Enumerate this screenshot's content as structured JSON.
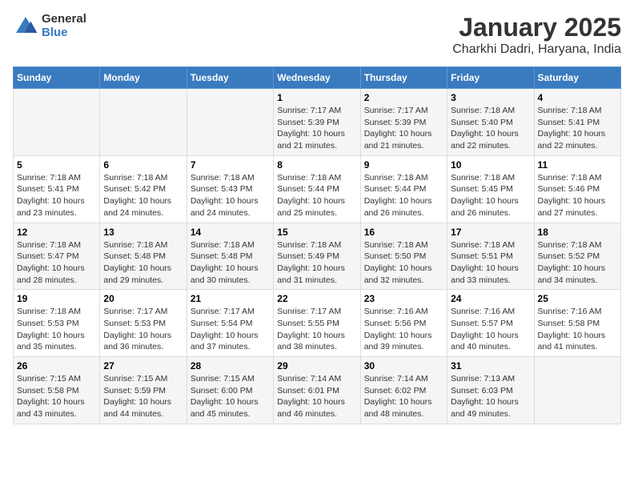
{
  "logo": {
    "general": "General",
    "blue": "Blue"
  },
  "title": "January 2025",
  "subtitle": "Charkhi Dadri, Haryana, India",
  "headers": [
    "Sunday",
    "Monday",
    "Tuesday",
    "Wednesday",
    "Thursday",
    "Friday",
    "Saturday"
  ],
  "weeks": [
    [
      {
        "day": "",
        "info": ""
      },
      {
        "day": "",
        "info": ""
      },
      {
        "day": "",
        "info": ""
      },
      {
        "day": "1",
        "info": "Sunrise: 7:17 AM\nSunset: 5:39 PM\nDaylight: 10 hours and 21 minutes."
      },
      {
        "day": "2",
        "info": "Sunrise: 7:17 AM\nSunset: 5:39 PM\nDaylight: 10 hours and 21 minutes."
      },
      {
        "day": "3",
        "info": "Sunrise: 7:18 AM\nSunset: 5:40 PM\nDaylight: 10 hours and 22 minutes."
      },
      {
        "day": "4",
        "info": "Sunrise: 7:18 AM\nSunset: 5:41 PM\nDaylight: 10 hours and 22 minutes."
      }
    ],
    [
      {
        "day": "5",
        "info": "Sunrise: 7:18 AM\nSunset: 5:41 PM\nDaylight: 10 hours and 23 minutes."
      },
      {
        "day": "6",
        "info": "Sunrise: 7:18 AM\nSunset: 5:42 PM\nDaylight: 10 hours and 24 minutes."
      },
      {
        "day": "7",
        "info": "Sunrise: 7:18 AM\nSunset: 5:43 PM\nDaylight: 10 hours and 24 minutes."
      },
      {
        "day": "8",
        "info": "Sunrise: 7:18 AM\nSunset: 5:44 PM\nDaylight: 10 hours and 25 minutes."
      },
      {
        "day": "9",
        "info": "Sunrise: 7:18 AM\nSunset: 5:44 PM\nDaylight: 10 hours and 26 minutes."
      },
      {
        "day": "10",
        "info": "Sunrise: 7:18 AM\nSunset: 5:45 PM\nDaylight: 10 hours and 26 minutes."
      },
      {
        "day": "11",
        "info": "Sunrise: 7:18 AM\nSunset: 5:46 PM\nDaylight: 10 hours and 27 minutes."
      }
    ],
    [
      {
        "day": "12",
        "info": "Sunrise: 7:18 AM\nSunset: 5:47 PM\nDaylight: 10 hours and 28 minutes."
      },
      {
        "day": "13",
        "info": "Sunrise: 7:18 AM\nSunset: 5:48 PM\nDaylight: 10 hours and 29 minutes."
      },
      {
        "day": "14",
        "info": "Sunrise: 7:18 AM\nSunset: 5:48 PM\nDaylight: 10 hours and 30 minutes."
      },
      {
        "day": "15",
        "info": "Sunrise: 7:18 AM\nSunset: 5:49 PM\nDaylight: 10 hours and 31 minutes."
      },
      {
        "day": "16",
        "info": "Sunrise: 7:18 AM\nSunset: 5:50 PM\nDaylight: 10 hours and 32 minutes."
      },
      {
        "day": "17",
        "info": "Sunrise: 7:18 AM\nSunset: 5:51 PM\nDaylight: 10 hours and 33 minutes."
      },
      {
        "day": "18",
        "info": "Sunrise: 7:18 AM\nSunset: 5:52 PM\nDaylight: 10 hours and 34 minutes."
      }
    ],
    [
      {
        "day": "19",
        "info": "Sunrise: 7:18 AM\nSunset: 5:53 PM\nDaylight: 10 hours and 35 minutes."
      },
      {
        "day": "20",
        "info": "Sunrise: 7:17 AM\nSunset: 5:53 PM\nDaylight: 10 hours and 36 minutes."
      },
      {
        "day": "21",
        "info": "Sunrise: 7:17 AM\nSunset: 5:54 PM\nDaylight: 10 hours and 37 minutes."
      },
      {
        "day": "22",
        "info": "Sunrise: 7:17 AM\nSunset: 5:55 PM\nDaylight: 10 hours and 38 minutes."
      },
      {
        "day": "23",
        "info": "Sunrise: 7:16 AM\nSunset: 5:56 PM\nDaylight: 10 hours and 39 minutes."
      },
      {
        "day": "24",
        "info": "Sunrise: 7:16 AM\nSunset: 5:57 PM\nDaylight: 10 hours and 40 minutes."
      },
      {
        "day": "25",
        "info": "Sunrise: 7:16 AM\nSunset: 5:58 PM\nDaylight: 10 hours and 41 minutes."
      }
    ],
    [
      {
        "day": "26",
        "info": "Sunrise: 7:15 AM\nSunset: 5:58 PM\nDaylight: 10 hours and 43 minutes."
      },
      {
        "day": "27",
        "info": "Sunrise: 7:15 AM\nSunset: 5:59 PM\nDaylight: 10 hours and 44 minutes."
      },
      {
        "day": "28",
        "info": "Sunrise: 7:15 AM\nSunset: 6:00 PM\nDaylight: 10 hours and 45 minutes."
      },
      {
        "day": "29",
        "info": "Sunrise: 7:14 AM\nSunset: 6:01 PM\nDaylight: 10 hours and 46 minutes."
      },
      {
        "day": "30",
        "info": "Sunrise: 7:14 AM\nSunset: 6:02 PM\nDaylight: 10 hours and 48 minutes."
      },
      {
        "day": "31",
        "info": "Sunrise: 7:13 AM\nSunset: 6:03 PM\nDaylight: 10 hours and 49 minutes."
      },
      {
        "day": "",
        "info": ""
      }
    ]
  ]
}
